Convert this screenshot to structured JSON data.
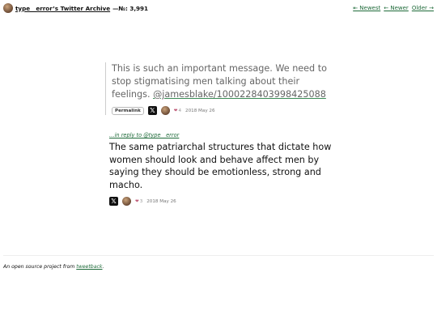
{
  "header": {
    "title_link": "type__error’s Twitter Archive",
    "count": "—№: 3,991",
    "nav": {
      "newest": "⇤ Newest",
      "newer": "← Newer",
      "older": "Older →"
    }
  },
  "parent_tweet": {
    "text": "This is such an important message. We need to stop stigmatising men talking about their feelings. ",
    "link": "@jamesblake/1000228403998425088",
    "permalink_label": "Permalink",
    "x_label": "𝕏",
    "likes": "4",
    "date": "2018 May 26"
  },
  "main_tweet": {
    "reply_to": "…in reply to @type__error",
    "text": "The same patriarchal structures that dictate how women should look and behave affect men by saying they should be emotionless, strong and macho.",
    "x_label": "𝕏",
    "likes": "3",
    "date": "2018 May 26"
  },
  "footer": {
    "prefix": "An open source project from ",
    "link": "tweetback",
    "suffix": "."
  },
  "colors": {
    "link_green": "#1f6b3a",
    "heart": "#c05d7a",
    "muted_text": "#666666"
  },
  "icons": [
    "avatar",
    "x-logo-icon",
    "heart-icon"
  ]
}
